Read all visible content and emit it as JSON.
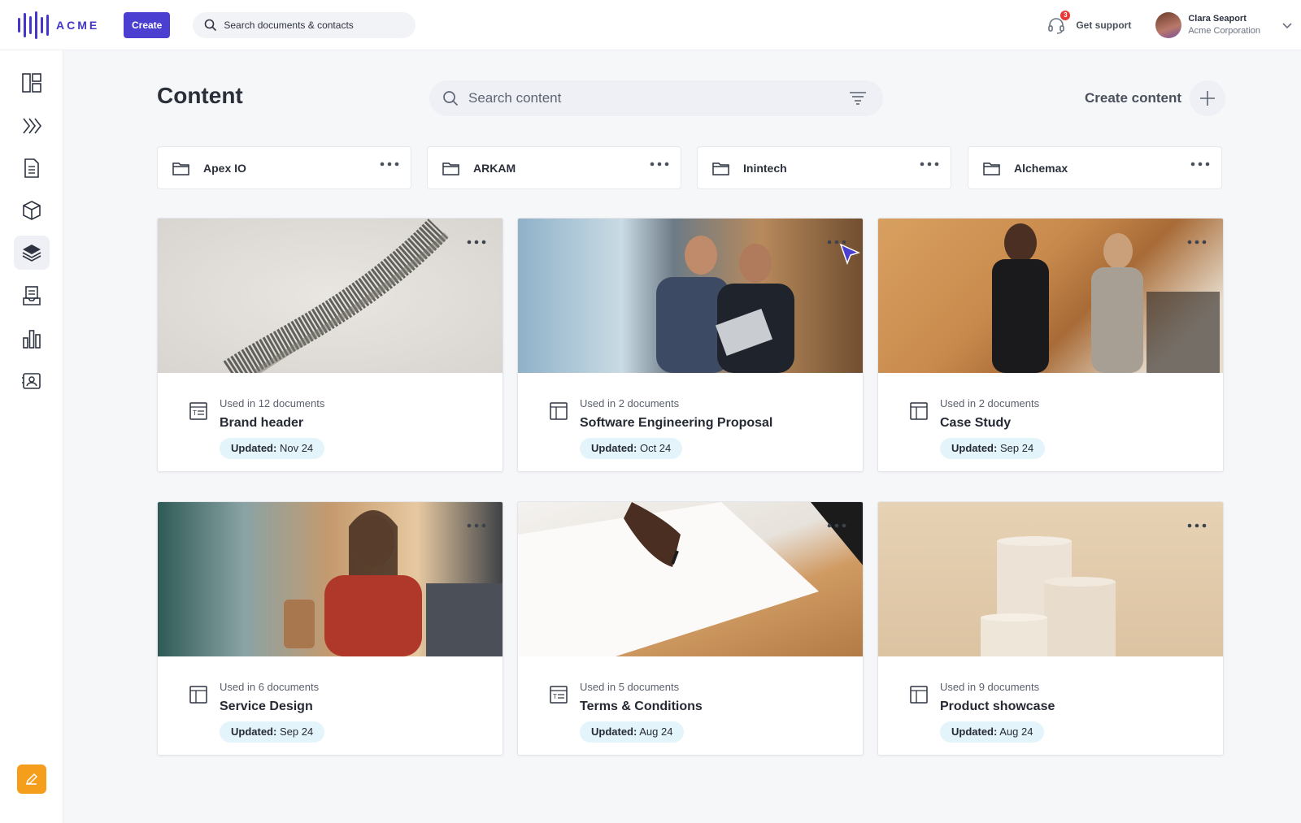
{
  "topbar": {
    "brand": "ACME",
    "create_label": "Create",
    "search_placeholder": "Search documents & contacts",
    "support_label": "Get support",
    "notification_count": "3",
    "user_name": "Clara Seaport",
    "user_org": "Acme Corporation"
  },
  "sidebar": {
    "items": [
      {
        "icon": "dashboard-icon"
      },
      {
        "icon": "workflow-icon"
      },
      {
        "icon": "document-icon"
      },
      {
        "icon": "box-icon"
      },
      {
        "icon": "layers-icon",
        "active": true
      },
      {
        "icon": "inbox-icon"
      },
      {
        "icon": "bar-chart-icon"
      },
      {
        "icon": "contact-card-icon"
      }
    ],
    "edit_icon": "pencil-icon"
  },
  "main": {
    "title": "Content",
    "search_placeholder": "Search content",
    "create_content_label": "Create content"
  },
  "folders": [
    {
      "name": "Apex IO"
    },
    {
      "name": "ARKAM"
    },
    {
      "name": "Inintech"
    },
    {
      "name": "Alchemax"
    }
  ],
  "cards": [
    {
      "used": "Used in 12 documents",
      "title": "Brand header",
      "updated_label": "Updated:",
      "updated_date": "Nov 24",
      "type_icon": "text-block-icon"
    },
    {
      "used": "Used in 2 documents",
      "title": "Software Engineering Proposal",
      "updated_label": "Updated:",
      "updated_date": "Oct 24",
      "type_icon": "layout-icon"
    },
    {
      "used": "Used in 2 documents",
      "title": "Case Study",
      "updated_label": "Updated:",
      "updated_date": "Sep 24",
      "type_icon": "layout-icon"
    },
    {
      "used": "Used in 6 documents",
      "title": "Service Design",
      "updated_label": "Updated:",
      "updated_date": "Sep 24",
      "type_icon": "layout-icon"
    },
    {
      "used": "Used in 5 documents",
      "title": "Terms & Conditions",
      "updated_label": "Updated:",
      "updated_date": "Aug 24",
      "type_icon": "text-block-icon"
    },
    {
      "used": "Used in 9 documents",
      "title": "Product showcase",
      "updated_label": "Updated:",
      "updated_date": "Aug 24",
      "type_icon": "layout-icon"
    }
  ],
  "colors": {
    "accent": "#4a3fd1",
    "badge": "#e53935",
    "edit_button": "#f59e1b",
    "updated_pill": "#e4f4fb"
  }
}
